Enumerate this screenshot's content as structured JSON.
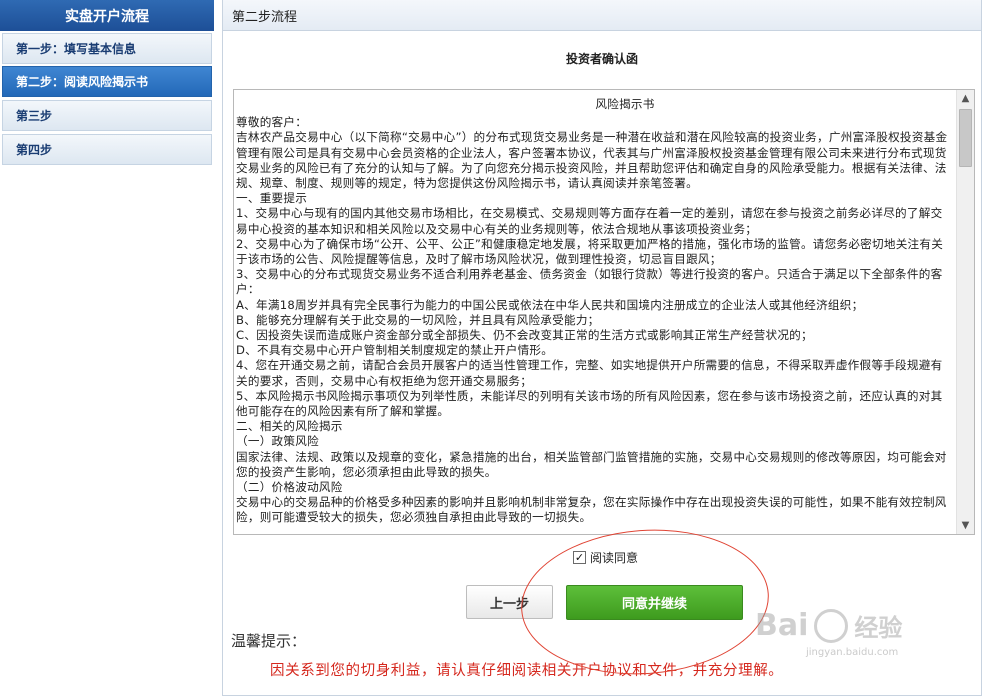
{
  "sidebar": {
    "title": "实盘开户流程",
    "steps": [
      {
        "label": "第一步：填写基本信息"
      },
      {
        "label": "第二步：阅读风险揭示书"
      },
      {
        "label": "第三步"
      },
      {
        "label": "第四步"
      }
    ]
  },
  "panel": {
    "header": "第二步流程",
    "confirm_title": "投资者确认函"
  },
  "risk": {
    "heading": "风险揭示书",
    "paragraphs": [
      "尊敬的客户：",
      "吉林农产品交易中心（以下简称“交易中心”）的分布式现货交易业务是一种潜在收益和潜在风险较高的投资业务，广州富泽股权投资基金管理有限公司是具有交易中心会员资格的企业法人，客户签署本协议，代表其与广州富泽股权投资基金管理有限公司未来进行分布式现货交易业务的风险已有了充分的认知与了解。为了向您充分揭示投资风险，并且帮助您评估和确定自身的风险承受能力。根据有关法律、法规、规章、制度、规则等的规定，特为您提供这份风险揭示书，请认真阅读并亲笔签署。",
      "一、重要提示",
      "1、交易中心与现有的国内其他交易市场相比，在交易模式、交易规则等方面存在着一定的差别，请您在参与投资之前务必详尽的了解交易中心投资的基本知识和相关风险以及交易中心有关的业务规则等，依法合规地从事该项投资业务；",
      "2、交易中心为了确保市场“公开、公平、公正”和健康稳定地发展，将采取更加严格的措施，强化市场的监管。请您务必密切地关注有关于该市场的公告、风险提醒等信息，及时了解市场风险状况，做到理性投资，切忌盲目跟风；",
      "3、交易中心的分布式现货交易业务不适合利用养老基金、债务资金（如银行贷款）等进行投资的客户。只适合于满足以下全部条件的客户：",
      "A、年满18周岁并具有完全民事行为能力的中国公民或依法在中华人民共和国境内注册成立的企业法人或其他经济组织；",
      "B、能够充分理解有关于此交易的一切风险，并且具有风险承受能力；",
      "C、因投资失误而造成账户资金部分或全部损失、仍不会改变其正常的生活方式或影响其正常生产经营状况的；",
      "D、不具有交易中心开户管制相关制度规定的禁止开户情形。",
      "4、您在开通交易之前，请配合会员开展客户的适当性管理工作，完整、如实地提供开户所需要的信息，不得采取弄虚作假等手段规避有关的要求，否则，交易中心有权拒绝为您开通交易服务；",
      "5、本风险揭示书风险揭示事项仅为列举性质，未能详尽的列明有关该市场的所有风险因素，您在参与该市场投资之前，还应认真的对其他可能存在的风险因素有所了解和掌握。",
      "二、相关的风险揭示",
      "（一）政策风险",
      "国家法律、法规、政策以及规章的变化，紧急措施的出台，相关监管部门监管措施的实施，交易中心交易规则的修改等原因，均可能会对您的投资产生影响，您必须承担由此导致的损失。",
      "（二）价格波动风险",
      "交易中心的交易品种的价格受多种因素的影响并且影响机制非常复杂，您在实际操作中存在出现投资失误的可能性，如果不能有效控制风险，则可能遭受较大的损失，您必须独自承担由此导致的一切损失。"
    ]
  },
  "agree": {
    "label": "阅读同意",
    "checked": true
  },
  "buttons": {
    "prev": "上一步",
    "next": "同意并继续"
  },
  "tip": {
    "label": "温馨提示：",
    "text": "因关系到您的切身利益，请认真仔细阅读相关开户协议和文件，并充分理解。"
  },
  "watermark": {
    "brand": "Bai",
    "brand2": "经验",
    "url": "jingyan.baidu.com"
  },
  "icons": {
    "scroll_up": "chevron-up-icon",
    "scroll_down": "chevron-down-icon",
    "check": "check-icon"
  },
  "colors": {
    "sidebar_header": "#1d4f97",
    "active_step": "#2369b8",
    "next_button": "#3e9b1e",
    "tip_text": "#d5281e",
    "annotation": "#e04434"
  }
}
